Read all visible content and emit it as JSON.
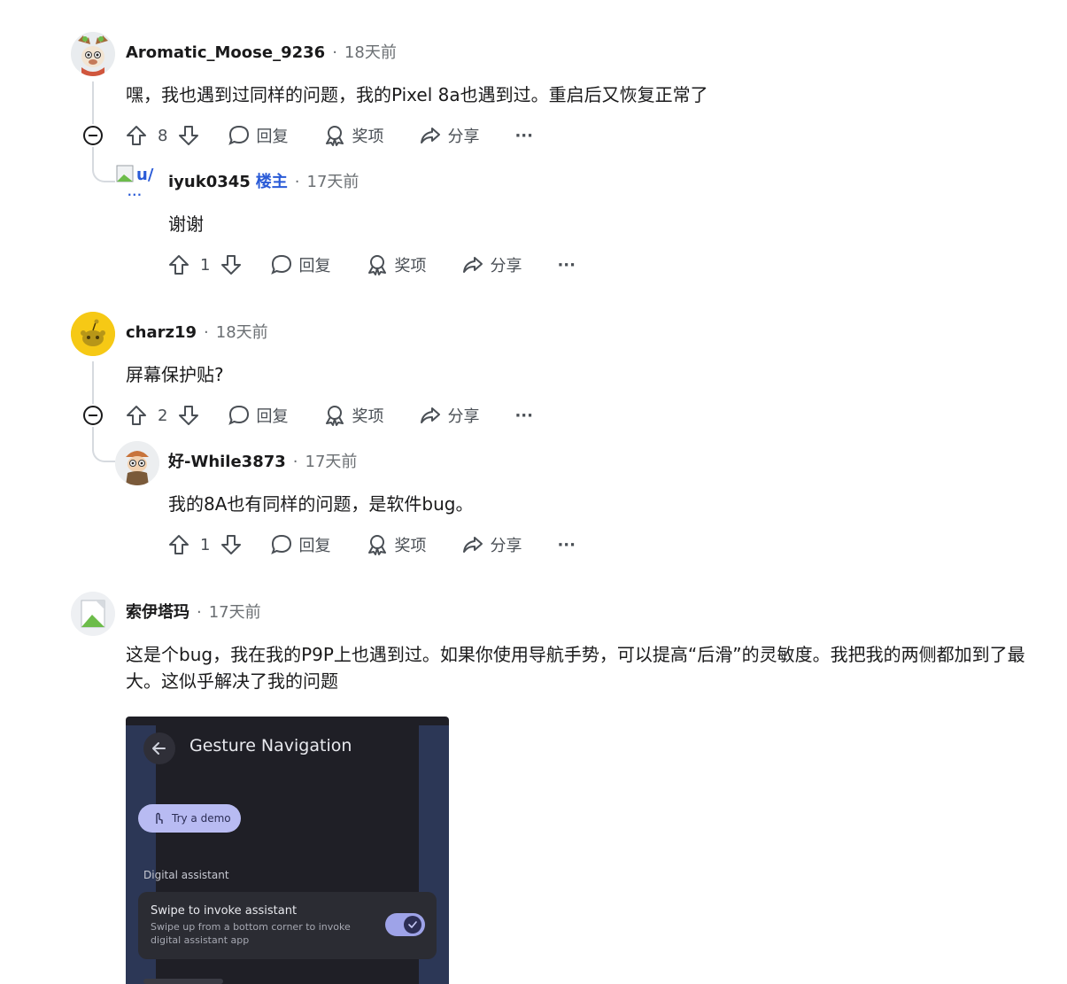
{
  "comments": [
    {
      "author": "Aromatic_Moose_9236",
      "time": "18天前",
      "body": "嘿，我也遇到过同样的问题，我的Pixel 8a也遇到过。重启后又恢复正常了",
      "votes": "8",
      "reply": "回复",
      "award": "奖项",
      "share": "分享",
      "more": "···"
    },
    {
      "author": "iyuk0345",
      "op_badge": "楼主",
      "avatar_alt": "u/",
      "time": "17天前",
      "body": "谢谢",
      "votes": "1",
      "reply": "回复",
      "award": "奖项",
      "share": "分享",
      "more": "···"
    },
    {
      "author": "charz19",
      "time": "18天前",
      "body": "屏幕保护贴?",
      "votes": "2",
      "reply": "回复",
      "award": "奖项",
      "share": "分享",
      "more": "···"
    },
    {
      "author": "好-While3873",
      "time": "17天前",
      "body": "我的8A也有同样的问题，是软件bug。",
      "votes": "1",
      "reply": "回复",
      "award": "奖项",
      "share": "分享",
      "more": "···"
    },
    {
      "author": "索伊塔玛",
      "time": "17天前",
      "body": "这是个bug，我在我的P9P上也遇到过。如果你使用导航手势，可以提高“后滑”的灵敏度。我把我的两侧都加到了最大。这似乎解决了我的问题"
    }
  ],
  "screenshot": {
    "title": "Gesture Navigation",
    "demo_button": "Try a demo",
    "section": "Digital assistant",
    "setting_title": "Swipe to invoke assistant",
    "setting_desc": "Swipe up from a bottom corner to invoke digital assistant app",
    "toggle_on": true
  },
  "colors": {
    "op_badge": "#2a5bd7",
    "meta": "#6b6f73",
    "thread_line": "#d6dadf",
    "shot_bg": "#1f1f26",
    "shot_side": "#2c3756",
    "demo_button": "#b8bbf2",
    "toggle": "#9ea3e8"
  }
}
